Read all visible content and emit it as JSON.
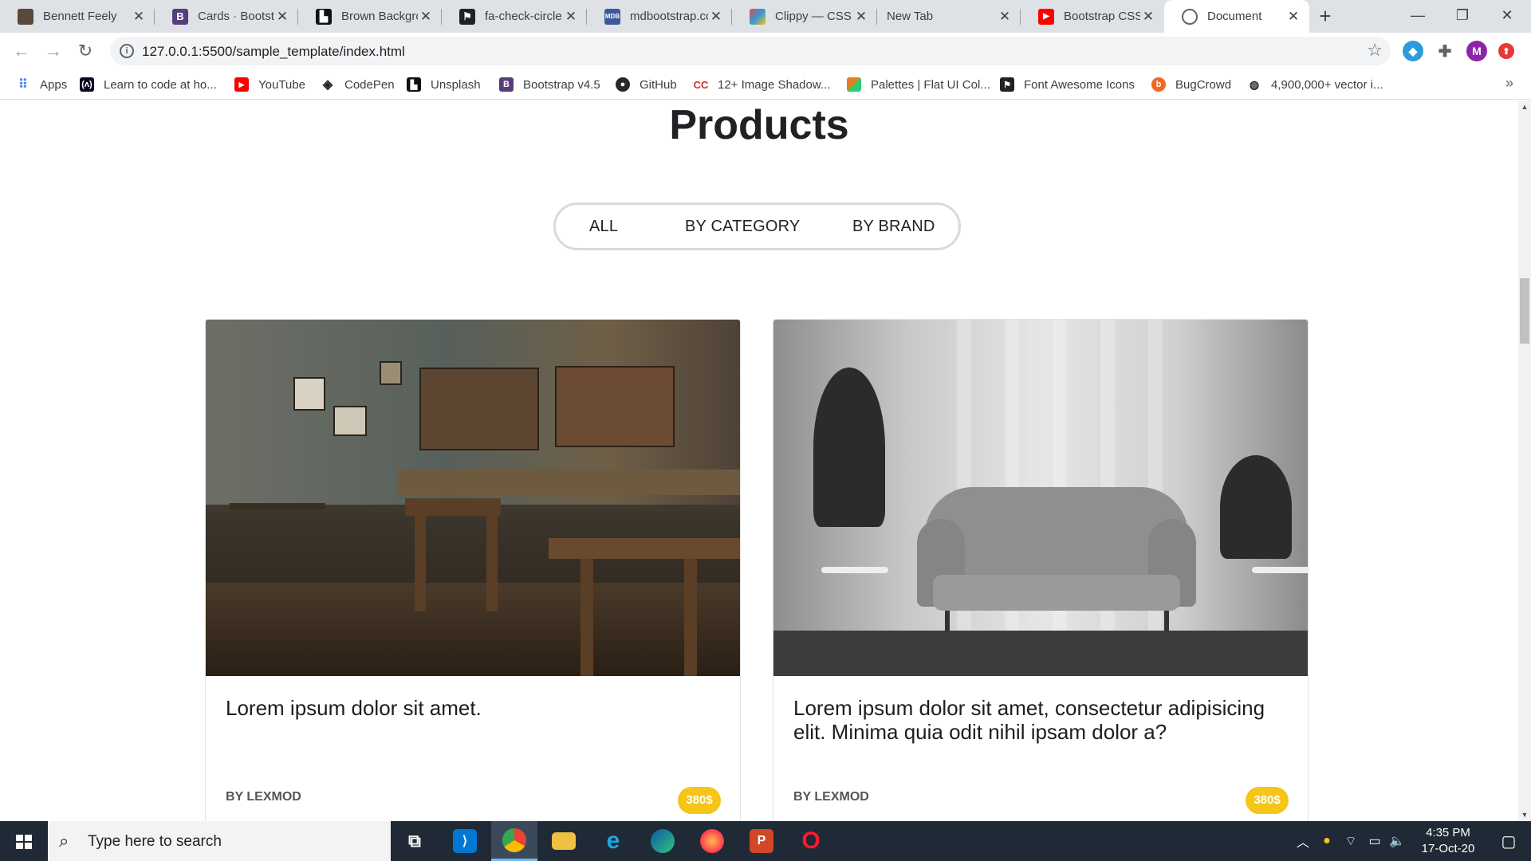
{
  "browser": {
    "tabs": [
      {
        "title": "Bennett Feely",
        "icon": "photo-avatar-icon",
        "color": "#5a4a3a"
      },
      {
        "title": "Cards · Bootstrap",
        "icon": "bootstrap-icon",
        "color": "#563d7c"
      },
      {
        "title": "Brown Backgro",
        "icon": "unsplash-icon",
        "color": "#111111"
      },
      {
        "title": "fa-check-circle",
        "icon": "font-awesome-icon",
        "color": "#222222"
      },
      {
        "title": "mdbootstrap.co",
        "icon": "mdb-icon",
        "color": "#3b5998"
      },
      {
        "title": "Clippy — CSS c",
        "icon": "clippy-icon",
        "color": "#e74c3c"
      },
      {
        "title": "New Tab",
        "icon": "",
        "color": ""
      },
      {
        "title": "Bootstrap CSS",
        "icon": "youtube-icon",
        "color": "#ff0000"
      },
      {
        "title": "Document",
        "icon": "globe-icon",
        "color": "#5f6368"
      }
    ],
    "active_tab_index": 8,
    "new_tab_label": "+",
    "window_controls": {
      "minimize": "—",
      "restore": "❐",
      "close": "✕"
    },
    "url": "127.0.0.1:5500/sample_template/index.html",
    "profile_initial": "M",
    "bookmarks": [
      {
        "label": "Apps",
        "icon": "apps-grid-icon",
        "color": "#4285f4"
      },
      {
        "label": "Learn to code at ho...",
        "icon": "freecodecamp-icon",
        "color": "#0a0a23"
      },
      {
        "label": "YouTube",
        "icon": "youtube-icon",
        "color": "#ff0000"
      },
      {
        "label": "CodePen",
        "icon": "codepen-icon",
        "color": "#222222"
      },
      {
        "label": "Unsplash",
        "icon": "unsplash-icon",
        "color": "#111111"
      },
      {
        "label": "Bootstrap v4.5",
        "icon": "bootstrap-icon",
        "color": "#563d7c"
      },
      {
        "label": "GitHub",
        "icon": "github-icon",
        "color": "#24292e"
      },
      {
        "label": "12+ Image Shadow...",
        "icon": "cc-icon",
        "color": "#d32f2f"
      },
      {
        "label": "Palettes | Flat UI Col...",
        "icon": "palette-icon",
        "color": "#e67e22"
      },
      {
        "label": "Font Awesome Icons",
        "icon": "font-awesome-icon",
        "color": "#222222"
      },
      {
        "label": "BugCrowd",
        "icon": "bugcrowd-icon",
        "color": "#f26822"
      },
      {
        "label": "4,900,000+ vector i...",
        "icon": "freepik-icon",
        "color": "#222222"
      }
    ],
    "bookmarks_more": "»"
  },
  "page": {
    "title": "Products",
    "filters": [
      "ALL",
      "BY CATEGORY",
      "BY BRAND"
    ],
    "products": [
      {
        "title": "Lorem ipsum dolor sit amet.",
        "brand": "BY LEXMOD",
        "price": "380$"
      },
      {
        "title": "Lorem ipsum dolor sit amet, consectetur adipisicing elit. Minima quia odit nihil ipsam dolor a?",
        "brand": "BY LEXMOD",
        "price": "380$"
      }
    ]
  },
  "taskbar": {
    "search_placeholder": "Type here to search",
    "apps": [
      "task-view",
      "vscode",
      "chrome",
      "file-explorer",
      "internet-explorer",
      "edge",
      "firefox",
      "powerpoint",
      "opera"
    ],
    "time": "4:35 PM",
    "date": "17-Oct-20"
  },
  "colors": {
    "price_badge": "#f5c518",
    "filter_border": "#dadada",
    "taskbar": "#1f2a36"
  }
}
